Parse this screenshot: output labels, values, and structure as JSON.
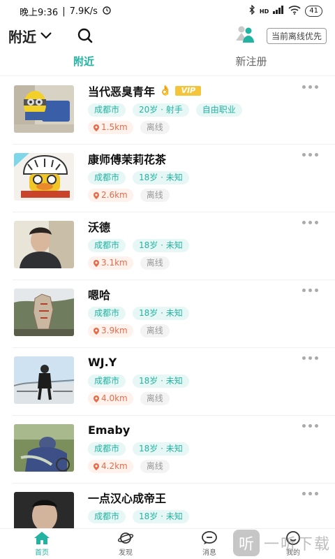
{
  "status_bar": {
    "time": "晚上9:36",
    "speed": "7.9K/s",
    "network": "HD",
    "battery": "41"
  },
  "header": {
    "location": "附近",
    "offline_button": "当前离线优先"
  },
  "tabs": [
    {
      "label": "附近"
    },
    {
      "label": "新注册"
    }
  ],
  "users": [
    {
      "name": "当代恶臭青年",
      "emoji": "👌",
      "vip": "VIP",
      "tags": [
        "成都市",
        "20岁 · 射手",
        "自由职业"
      ],
      "distance": "1.5km",
      "status": "离线"
    },
    {
      "name": "康师傅茉莉花茶",
      "tags": [
        "成都市",
        "18岁 · 未知"
      ],
      "distance": "2.6km",
      "status": "离线"
    },
    {
      "name": "沃德",
      "tags": [
        "成都市",
        "18岁 · 未知"
      ],
      "distance": "3.1km",
      "status": "离线"
    },
    {
      "name": "嗯哈",
      "tags": [
        "成都市",
        "18岁 · 未知"
      ],
      "distance": "3.9km",
      "status": "离线"
    },
    {
      "name": "WJ.Y",
      "tags": [
        "成都市",
        "18岁 · 未知"
      ],
      "distance": "4.0km",
      "status": "离线"
    },
    {
      "name": "Emaby",
      "tags": [
        "成都市",
        "18岁 · 未知"
      ],
      "distance": "4.2km",
      "status": "离线"
    },
    {
      "name": "一点汉心成帝王",
      "tags": [
        "成都市",
        "18岁 · 未知"
      ],
      "distance": "",
      "status": ""
    }
  ],
  "bottom_nav": [
    {
      "label": "首页",
      "icon": "home-icon"
    },
    {
      "label": "发现",
      "icon": "planet-icon"
    },
    {
      "label": "消息",
      "icon": "message-icon"
    },
    {
      "label": "我的",
      "icon": "profile-icon"
    }
  ],
  "watermark": {
    "logo": "听",
    "text": "一听下载"
  },
  "colors": {
    "accent": "#23b3a2",
    "distance": "#e36d4a",
    "vip": "#f4c53b"
  }
}
